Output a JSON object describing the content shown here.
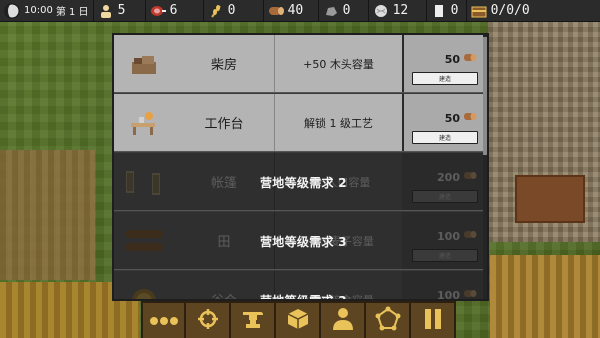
{
  "topbar": {
    "time": "10:00",
    "day": "第 1 日",
    "population": "5",
    "meat": "6",
    "wheat": "0",
    "wood": "40",
    "stone": "0",
    "wool": "12",
    "paper": "0",
    "chest": "0/0/0"
  },
  "panel": {
    "rows": [
      {
        "name": "柴房",
        "desc": "+50 木头容量",
        "cost": "50",
        "button": "建造",
        "lock": ""
      },
      {
        "name": "工作台",
        "desc": "解锁 1 级工艺",
        "cost": "50",
        "button": "建造",
        "lock": ""
      },
      {
        "name": "帐篷",
        "desc": "+2 人口容量",
        "cost": "200",
        "button": "建造",
        "lock": "营地等级需求 2"
      },
      {
        "name": "田",
        "desc": "+10 麦子容量",
        "cost": "100",
        "button": "建造",
        "lock": "营地等级需求 3"
      },
      {
        "name": "谷仓",
        "desc": "+50 粮食容量",
        "cost": "100",
        "button": "建造",
        "lock": "营地等级需求 3"
      }
    ]
  },
  "toolbar": {
    "items": [
      "more-icon",
      "target-icon",
      "anvil-icon",
      "crate-icon",
      "person-icon",
      "network-icon",
      "pause-icon"
    ]
  },
  "colors": {
    "panel_available": "#b4b4b4",
    "panel_locked": "#2f2f2f",
    "toolbar_bg": "#5c4520",
    "toolbar_icon": "#e9c25a",
    "wood_icon": "#c98a4a"
  }
}
